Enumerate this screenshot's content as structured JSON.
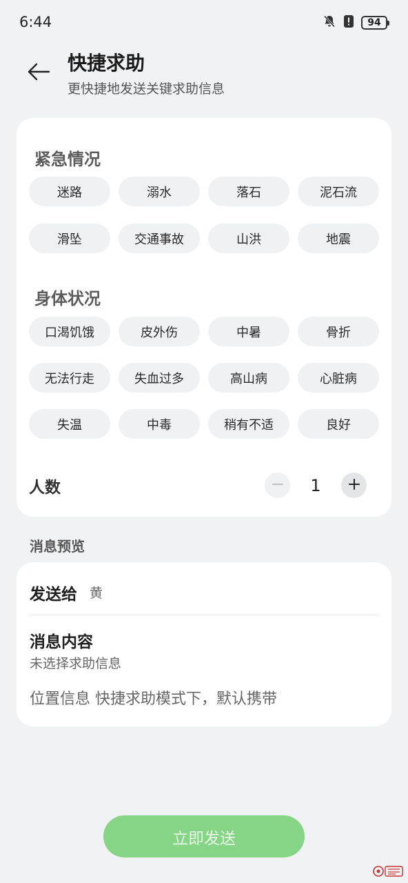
{
  "status_bar": {
    "time": "6:44",
    "battery": "94"
  },
  "header": {
    "title": "快捷求助",
    "subtitle": "更快捷地发送关键求助信息"
  },
  "emergency": {
    "title": "紧急情况",
    "items": [
      "迷路",
      "溺水",
      "落石",
      "泥石流",
      "滑坠",
      "交通事故",
      "山洪",
      "地震"
    ]
  },
  "body_status": {
    "title": "身体状况",
    "items": [
      "口渴饥饿",
      "皮外伤",
      "中暑",
      "骨折",
      "无法行走",
      "失血过多",
      "高山病",
      "心脏病",
      "失温",
      "中毒",
      "稍有不适",
      "良好"
    ]
  },
  "people": {
    "label": "人数",
    "count": "1"
  },
  "preview": {
    "section_label": "消息预览",
    "send_to_label": "发送给",
    "send_to_value": "黄",
    "content_label": "消息内容",
    "content_value": "未选择求助信息",
    "location_text": "位置信息  快捷求助模式下，默认携带"
  },
  "send_button": {
    "label": "立即发送"
  },
  "colors": {
    "accent": "#86d486",
    "chip_bg": "#f0f1f3",
    "card_bg": "#ffffff",
    "page_bg": "#f1f2f4"
  }
}
